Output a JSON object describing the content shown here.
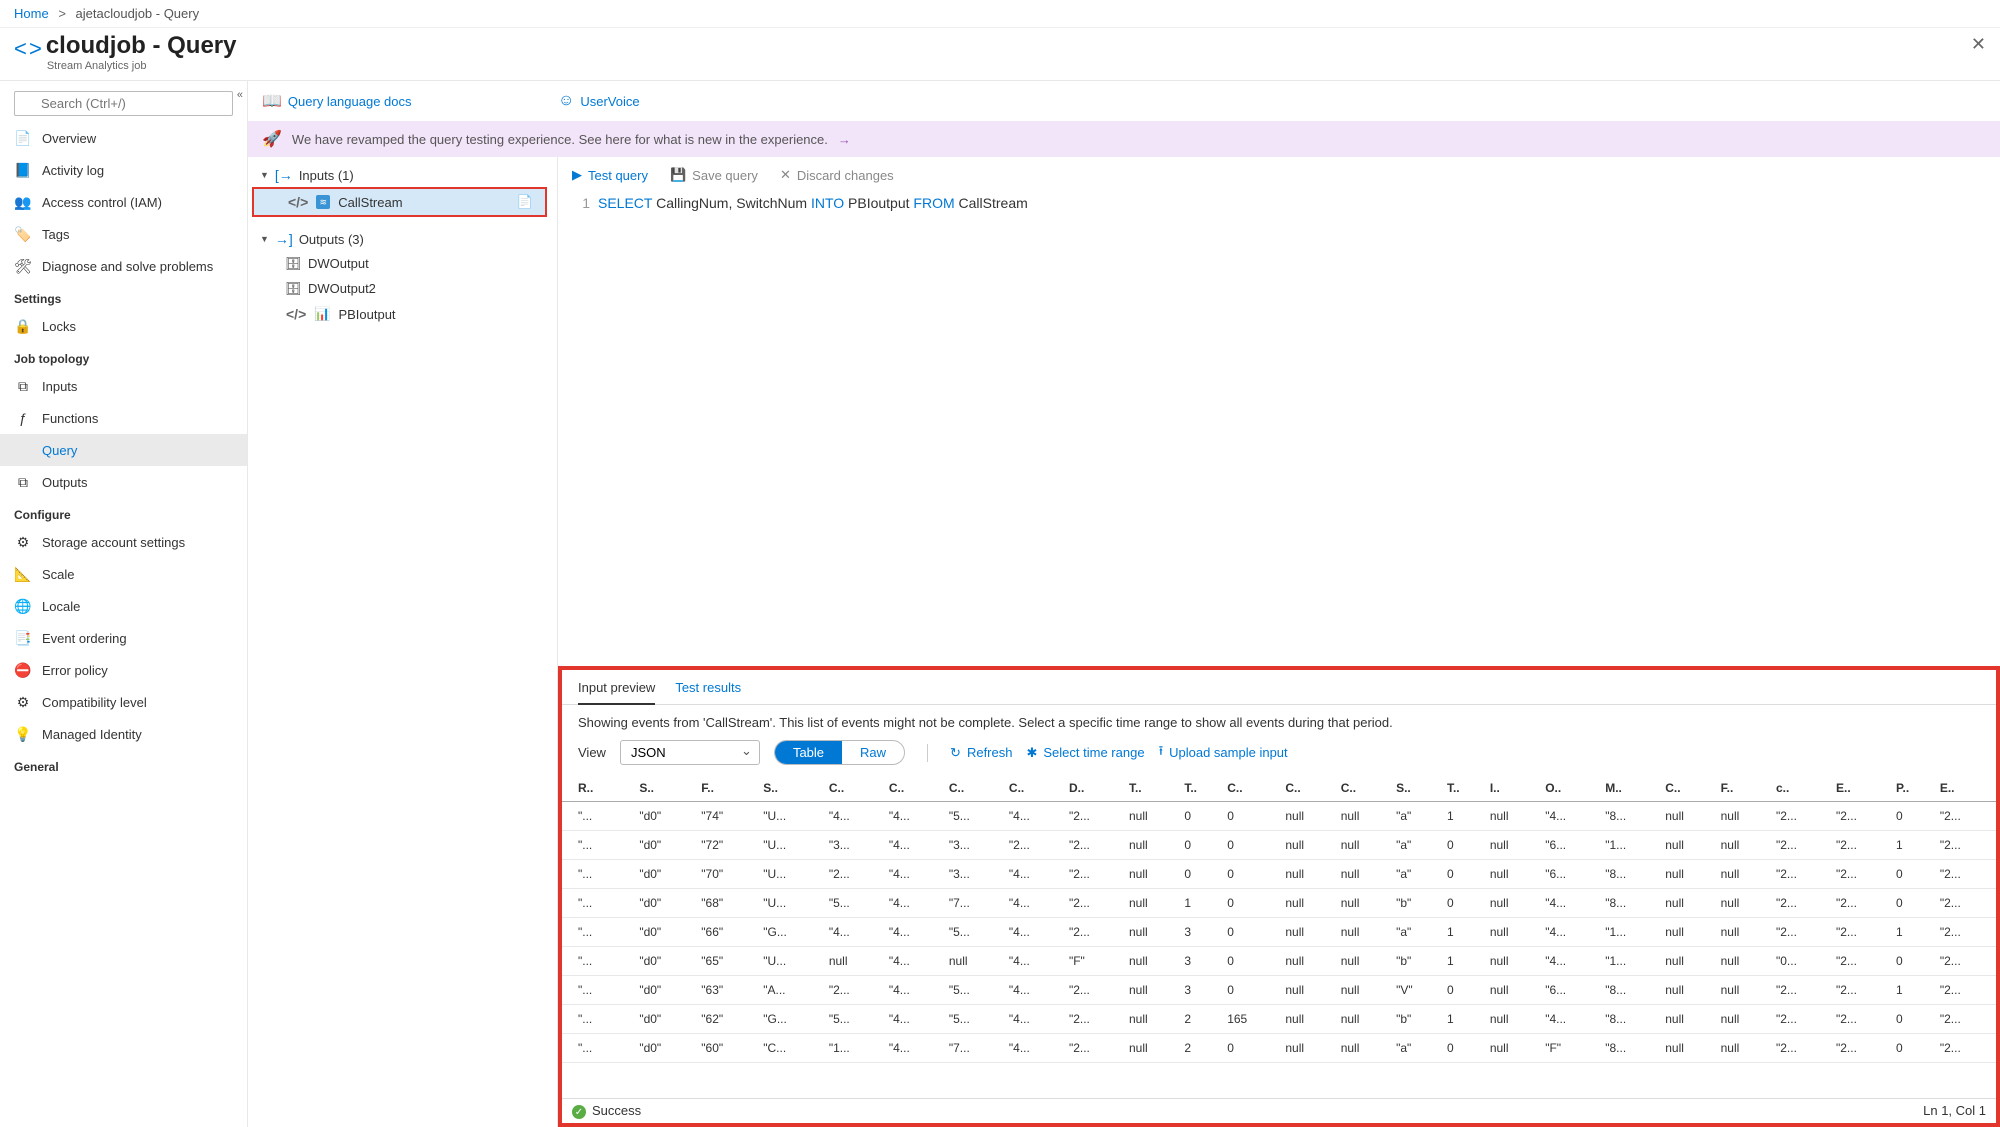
{
  "breadcrumb": {
    "home": "Home",
    "current": "ajetacloudjob - Query"
  },
  "header": {
    "title": "cloudjob - Query",
    "subtitle": "Stream Analytics job"
  },
  "search": {
    "placeholder": "Search (Ctrl+/)"
  },
  "nav": {
    "top": [
      {
        "icon": "📄",
        "label": "Overview",
        "key": "overview"
      },
      {
        "icon": "📘",
        "label": "Activity log",
        "key": "activity-log"
      },
      {
        "icon": "👥",
        "label": "Access control (IAM)",
        "key": "iam"
      },
      {
        "icon": "🏷️",
        "label": "Tags",
        "key": "tags"
      },
      {
        "icon": "🛠",
        "label": "Diagnose and solve problems",
        "key": "diagnose"
      }
    ],
    "settings_label": "Settings",
    "settings": [
      {
        "icon": "🔒",
        "label": "Locks",
        "key": "locks"
      }
    ],
    "topology_label": "Job topology",
    "topology": [
      {
        "icon": "⧉",
        "label": "Inputs",
        "key": "inputs"
      },
      {
        "icon": "ƒ",
        "label": "Functions",
        "key": "functions"
      },
      {
        "icon": "</>",
        "label": "Query",
        "key": "query",
        "active": true
      },
      {
        "icon": "⧉",
        "label": "Outputs",
        "key": "outputs"
      }
    ],
    "configure_label": "Configure",
    "configure": [
      {
        "icon": "⚙",
        "label": "Storage account settings",
        "key": "storage"
      },
      {
        "icon": "📐",
        "label": "Scale",
        "key": "scale"
      },
      {
        "icon": "🌐",
        "label": "Locale",
        "key": "locale"
      },
      {
        "icon": "📑",
        "label": "Event ordering",
        "key": "event-ordering"
      },
      {
        "icon": "⛔",
        "label": "Error policy",
        "key": "error-policy"
      },
      {
        "icon": "⚙",
        "label": "Compatibility level",
        "key": "compat"
      },
      {
        "icon": "💡",
        "label": "Managed Identity",
        "key": "identity"
      }
    ],
    "general_label": "General"
  },
  "toolbar": {
    "docs": "Query language docs",
    "uservoice": "UserVoice"
  },
  "banner": "We have revamped the query testing experience. See here for what is new in the experience.",
  "tree": {
    "inputs_label": "Inputs (1)",
    "inputs": [
      {
        "name": "CallStream",
        "selected": true
      }
    ],
    "outputs_label": "Outputs (3)",
    "outputs": [
      {
        "name": "DWOutput",
        "icon": "db"
      },
      {
        "name": "DWOutput2",
        "icon": "db"
      },
      {
        "name": "PBIoutput",
        "icon": "pbi"
      }
    ]
  },
  "editor": {
    "test": "Test query",
    "save": "Save query",
    "discard": "Discard changes",
    "line_no": "1",
    "query": {
      "kw1": "SELECT",
      "cols": "CallingNum, SwitchNum",
      "kw2": "INTO",
      "into": "PBIoutput",
      "kw3": "FROM",
      "from": "CallStream"
    }
  },
  "results": {
    "tab1": "Input preview",
    "tab2": "Test results",
    "info": "Showing events from 'CallStream'. This list of events might not be complete. Select a specific time range to show all events during that period.",
    "view_label": "View",
    "view_value": "JSON",
    "toggle_table": "Table",
    "toggle_raw": "Raw",
    "refresh": "Refresh",
    "select_range": "Select time range",
    "upload": "Upload sample input",
    "headers": [
      "R..",
      "S..",
      "F..",
      "S..",
      "C..",
      "C..",
      "C..",
      "C..",
      "D..",
      "T..",
      "T..",
      "C..",
      "C..",
      "C..",
      "S..",
      "T..",
      "I..",
      "O..",
      "M..",
      "C..",
      "F..",
      "c..",
      "E..",
      "P..",
      "E.."
    ],
    "rows": [
      [
        "\"...",
        "\"d0\"",
        "\"74\"",
        "\"U...",
        "\"4...",
        "\"4...",
        "\"5...",
        "\"4...",
        "\"2...",
        "null",
        "0",
        "0",
        "null",
        "null",
        "\"a\"",
        "1",
        "null",
        "\"4...",
        "\"8...",
        "null",
        "null",
        "\"2...",
        "\"2...",
        "0",
        "\"2..."
      ],
      [
        "\"...",
        "\"d0\"",
        "\"72\"",
        "\"U...",
        "\"3...",
        "\"4...",
        "\"3...",
        "\"2...",
        "\"2...",
        "null",
        "0",
        "0",
        "null",
        "null",
        "\"a\"",
        "0",
        "null",
        "\"6...",
        "\"1...",
        "null",
        "null",
        "\"2...",
        "\"2...",
        "1",
        "\"2..."
      ],
      [
        "\"...",
        "\"d0\"",
        "\"70\"",
        "\"U...",
        "\"2...",
        "\"4...",
        "\"3...",
        "\"4...",
        "\"2...",
        "null",
        "0",
        "0",
        "null",
        "null",
        "\"a\"",
        "0",
        "null",
        "\"6...",
        "\"8...",
        "null",
        "null",
        "\"2...",
        "\"2...",
        "0",
        "\"2..."
      ],
      [
        "\"...",
        "\"d0\"",
        "\"68\"",
        "\"U...",
        "\"5...",
        "\"4...",
        "\"7...",
        "\"4...",
        "\"2...",
        "null",
        "1",
        "0",
        "null",
        "null",
        "\"b\"",
        "0",
        "null",
        "\"4...",
        "\"8...",
        "null",
        "null",
        "\"2...",
        "\"2...",
        "0",
        "\"2..."
      ],
      [
        "\"...",
        "\"d0\"",
        "\"66\"",
        "\"G...",
        "\"4...",
        "\"4...",
        "\"5...",
        "\"4...",
        "\"2...",
        "null",
        "3",
        "0",
        "null",
        "null",
        "\"a\"",
        "1",
        "null",
        "\"4...",
        "\"1...",
        "null",
        "null",
        "\"2...",
        "\"2...",
        "1",
        "\"2..."
      ],
      [
        "\"...",
        "\"d0\"",
        "\"65\"",
        "\"U...",
        "null",
        "\"4...",
        "null",
        "\"4...",
        "\"F\"",
        "null",
        "3",
        "0",
        "null",
        "null",
        "\"b\"",
        "1",
        "null",
        "\"4...",
        "\"1...",
        "null",
        "null",
        "\"0...",
        "\"2...",
        "0",
        "\"2..."
      ],
      [
        "\"...",
        "\"d0\"",
        "\"63\"",
        "\"A...",
        "\"2...",
        "\"4...",
        "\"5...",
        "\"4...",
        "\"2...",
        "null",
        "3",
        "0",
        "null",
        "null",
        "\"V\"",
        "0",
        "null",
        "\"6...",
        "\"8...",
        "null",
        "null",
        "\"2...",
        "\"2...",
        "1",
        "\"2..."
      ],
      [
        "\"...",
        "\"d0\"",
        "\"62\"",
        "\"G...",
        "\"5...",
        "\"4...",
        "\"5...",
        "\"4...",
        "\"2...",
        "null",
        "2",
        "165",
        "null",
        "null",
        "\"b\"",
        "1",
        "null",
        "\"4...",
        "\"8...",
        "null",
        "null",
        "\"2...",
        "\"2...",
        "0",
        "\"2..."
      ],
      [
        "\"...",
        "\"d0\"",
        "\"60\"",
        "\"C...",
        "\"1...",
        "\"4...",
        "\"7...",
        "\"4...",
        "\"2...",
        "null",
        "2",
        "0",
        "null",
        "null",
        "\"a\"",
        "0",
        "null",
        "\"F\"",
        "\"8...",
        "null",
        "null",
        "\"2...",
        "\"2...",
        "0",
        "\"2..."
      ]
    ],
    "status_text": "Success",
    "cursor": "Ln 1, Col 1"
  }
}
